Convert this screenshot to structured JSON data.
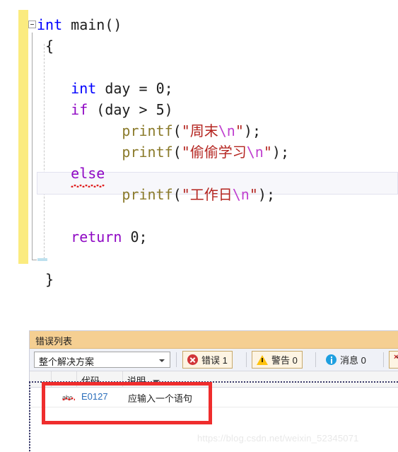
{
  "editor": {
    "language": "c",
    "gutter": {
      "change_bar_color": "#fbeb7f",
      "collapse_icon": "collapse-minus-icon"
    },
    "lines": [
      {
        "id": "l1",
        "indent": 0,
        "tokens": [
          {
            "t": "int",
            "c": "kw-blue"
          },
          {
            "t": " ",
            "c": "punct"
          },
          {
            "t": "main",
            "c": "ident"
          },
          {
            "t": "()",
            "c": "punct"
          }
        ]
      },
      {
        "id": "l2",
        "indent": 1,
        "tokens": [
          {
            "t": "{",
            "c": "punct"
          }
        ]
      },
      {
        "id": "l3",
        "indent": 0,
        "tokens": []
      },
      {
        "id": "l4",
        "indent": 4,
        "tokens": [
          {
            "t": "int",
            "c": "kw-blue"
          },
          {
            "t": " day = ",
            "c": "ident"
          },
          {
            "t": "0",
            "c": "num"
          },
          {
            "t": ";",
            "c": "punct"
          }
        ]
      },
      {
        "id": "l5",
        "indent": 4,
        "tokens": [
          {
            "t": "if",
            "c": "kw-purple"
          },
          {
            "t": " (day > ",
            "c": "ident"
          },
          {
            "t": "5",
            "c": "num"
          },
          {
            "t": ")",
            "c": "punct"
          }
        ]
      },
      {
        "id": "l6",
        "indent": 10,
        "tokens": [
          {
            "t": "printf",
            "c": "fn"
          },
          {
            "t": "(",
            "c": "punct"
          },
          {
            "t": "\"周末",
            "c": "str"
          },
          {
            "t": "\\n",
            "c": "esc"
          },
          {
            "t": "\"",
            "c": "str"
          },
          {
            "t": ");",
            "c": "punct"
          }
        ]
      },
      {
        "id": "l7",
        "indent": 10,
        "tokens": [
          {
            "t": "printf",
            "c": "fn"
          },
          {
            "t": "(",
            "c": "punct"
          },
          {
            "t": "\"偷偷学习",
            "c": "str"
          },
          {
            "t": "\\n",
            "c": "esc"
          },
          {
            "t": "\"",
            "c": "str"
          },
          {
            "t": ");",
            "c": "punct"
          }
        ]
      },
      {
        "id": "l8",
        "indent": 4,
        "tokens": [
          {
            "t": "else",
            "c": "kw-purple",
            "squiggle": true
          }
        ]
      },
      {
        "id": "l9",
        "indent": 10,
        "tokens": [
          {
            "t": "printf",
            "c": "fn"
          },
          {
            "t": "(",
            "c": "punct"
          },
          {
            "t": "\"工作日",
            "c": "str"
          },
          {
            "t": "\\n",
            "c": "esc"
          },
          {
            "t": "\"",
            "c": "str"
          },
          {
            "t": ");",
            "c": "punct"
          }
        ]
      },
      {
        "id": "l10",
        "indent": 0,
        "tokens": []
      },
      {
        "id": "l11",
        "indent": 4,
        "tokens": [
          {
            "t": "return",
            "c": "kw-purple"
          },
          {
            "t": " ",
            "c": "punct"
          },
          {
            "t": "0",
            "c": "num"
          },
          {
            "t": ";",
            "c": "punct"
          }
        ]
      },
      {
        "id": "l12",
        "indent": 0,
        "tokens": []
      },
      {
        "id": "l13",
        "indent": 1,
        "tokens": [
          {
            "t": "}",
            "c": "punct"
          }
        ]
      }
    ]
  },
  "error_list": {
    "title": "错误列表",
    "scope_filter": {
      "value": "整个解决方案",
      "caret": "chevron-down-icon"
    },
    "toolbar": [
      {
        "key": "errors",
        "icon": "error-icon",
        "label": "错误 1",
        "active": true
      },
      {
        "key": "warnings",
        "icon": "warning-icon",
        "label": "警告 0",
        "active": true
      },
      {
        "key": "messages",
        "icon": "info-icon",
        "label": "消息 0",
        "active": true
      },
      {
        "key": "clear_filter",
        "icon": "clear-filter-icon",
        "label": "",
        "active": true
      }
    ],
    "columns": [
      {
        "key": "severity",
        "label": ""
      },
      {
        "key": "code",
        "label": "代码"
      },
      {
        "key": "desc",
        "label": "说明",
        "sorted": true
      }
    ],
    "rows": [
      {
        "icon": "intellisense-abc-icon",
        "code": "E0127",
        "desc": "应输入一个语句"
      }
    ]
  },
  "annotation": {
    "highlight_color": "#ef2d2d"
  },
  "watermark": {
    "text": "https://blog.csdn.net/weixin_52345071"
  }
}
